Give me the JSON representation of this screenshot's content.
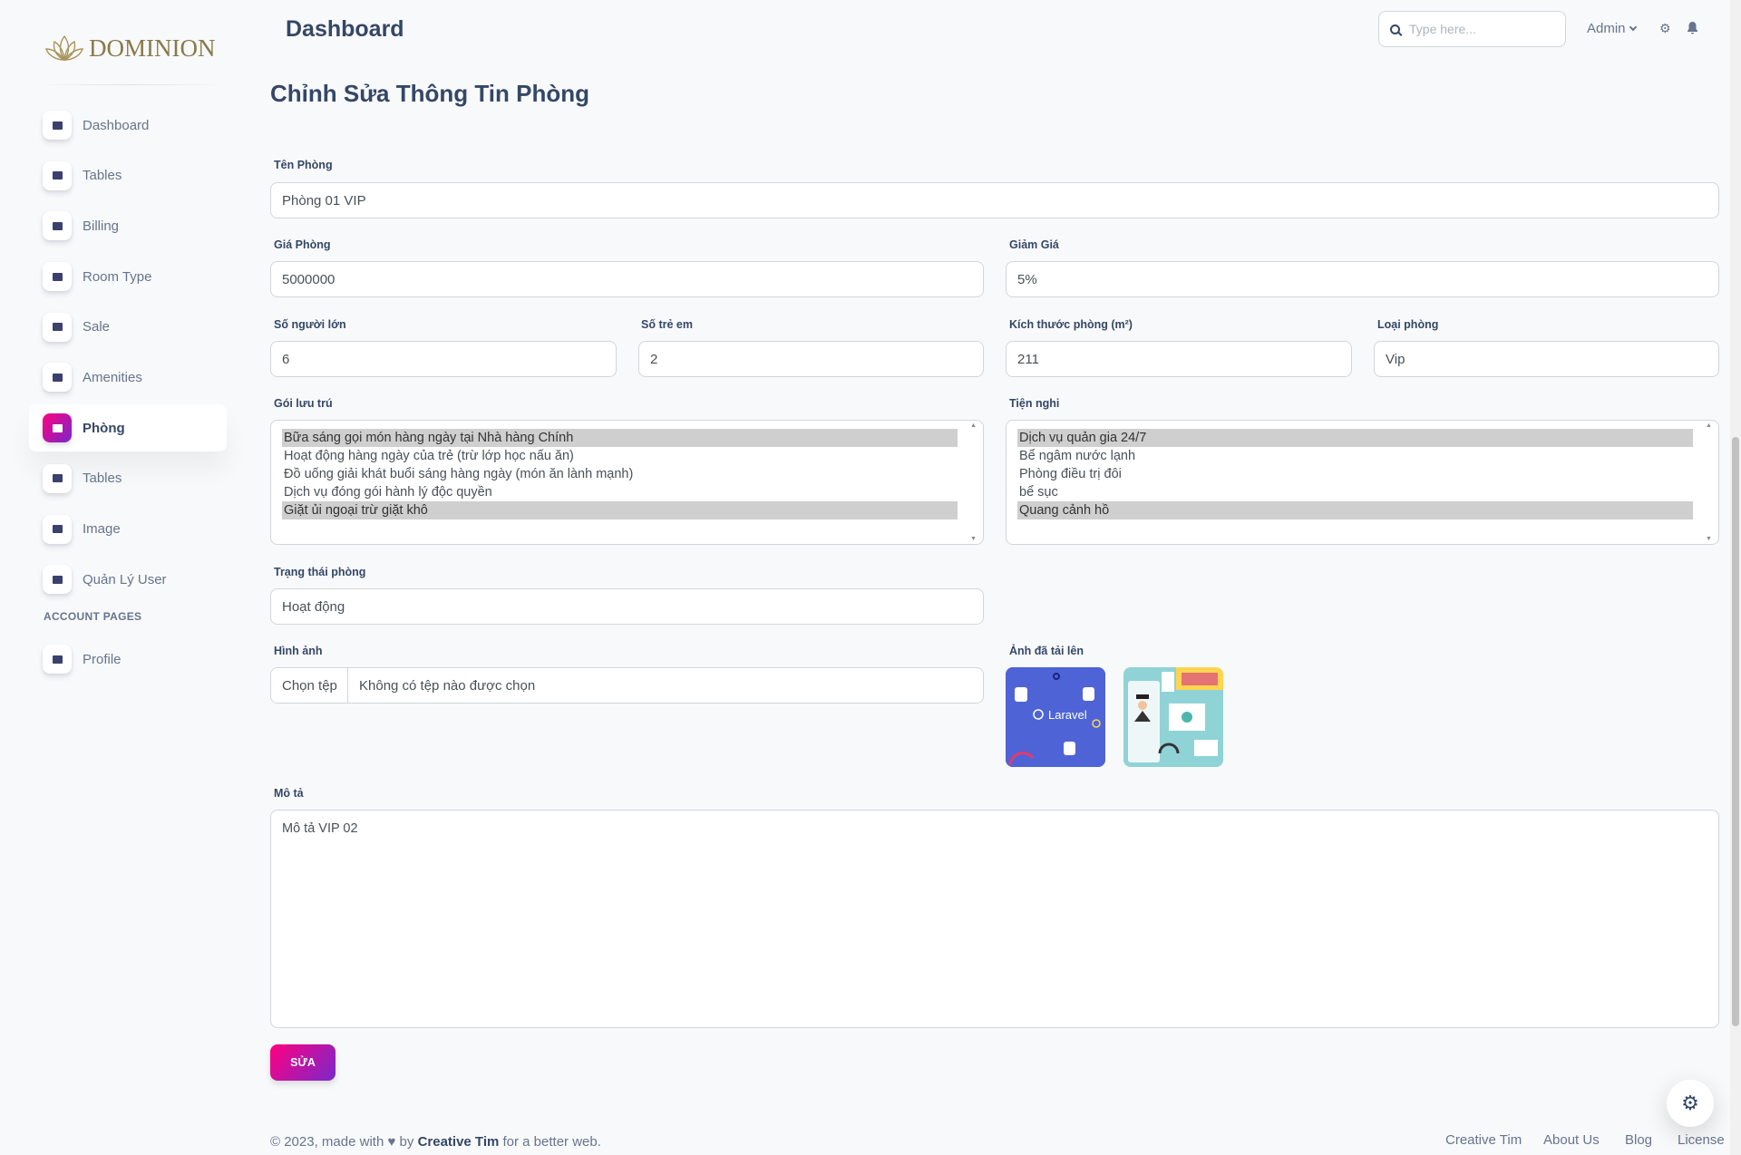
{
  "brand": {
    "name": "DOMINION"
  },
  "sidebar": {
    "items": [
      {
        "label": "Dashboard",
        "icon": "shop-icon"
      },
      {
        "label": "Tables",
        "icon": "office-icon"
      },
      {
        "label": "Billing",
        "icon": "credit-card-icon"
      },
      {
        "label": "Room Type",
        "icon": "app-icon"
      },
      {
        "label": "Sale",
        "icon": "app-icon"
      },
      {
        "label": "Amenities",
        "icon": "app-icon"
      },
      {
        "label": "Phòng",
        "icon": "shop-icon",
        "active": true
      },
      {
        "label": "Tables",
        "icon": "office-icon"
      },
      {
        "label": "Image",
        "icon": "credit-card-icon"
      },
      {
        "label": "Quản Lý User",
        "icon": "credit-card-icon"
      }
    ],
    "section_label": "ACCOUNT PAGES",
    "account_items": [
      {
        "label": "Profile",
        "icon": "user-icon"
      }
    ]
  },
  "header": {
    "title": "Dashboard",
    "search_placeholder": "Type here...",
    "user": "Admin"
  },
  "form": {
    "heading": "Chỉnh Sửa Thông Tin Phòng",
    "room_name": {
      "label": "Tên Phòng",
      "value": "Phòng 01 VIP"
    },
    "price": {
      "label": "Giá Phòng",
      "value": "5000000"
    },
    "discount": {
      "label": "Giảm Giá",
      "value": "5%"
    },
    "adults": {
      "label": "Số người lớn",
      "value": "6"
    },
    "children": {
      "label": "Số trẻ em",
      "value": "2"
    },
    "size": {
      "label": "Kích thước phòng (m²)",
      "value": "211"
    },
    "room_type": {
      "label": "Loại phòng",
      "value": "Vip"
    },
    "packages": {
      "label": "Gói lưu trú",
      "options": [
        {
          "text": "Bữa sáng gọi món hàng ngày tại Nhà hàng Chính",
          "selected": true
        },
        {
          "text": "Hoạt động hàng ngày của trẻ (trừ lớp học nấu ăn)",
          "selected": false
        },
        {
          "text": "Đồ uống giải khát buổi sáng hàng ngày (món ăn lành mạnh)",
          "selected": false
        },
        {
          "text": "Dịch vụ đóng gói hành lý độc quyền",
          "selected": false
        },
        {
          "text": "Giặt ủi ngoại trừ giặt khô",
          "selected": true
        }
      ]
    },
    "amenities": {
      "label": "Tiện nghi",
      "options": [
        {
          "text": "Dịch vụ quản gia 24/7",
          "selected": true
        },
        {
          "text": "Bể ngâm nước lạnh",
          "selected": false
        },
        {
          "text": "Phòng điều trị đôi",
          "selected": false
        },
        {
          "text": "bể sục",
          "selected": false
        },
        {
          "text": "Quang cảnh hồ",
          "selected": true
        }
      ]
    },
    "status": {
      "label": "Trạng thái phòng",
      "value": "Hoạt động"
    },
    "image": {
      "label": "Hình ảnh",
      "button": "Chọn tệp",
      "file_text": "Không có tệp nào được chọn"
    },
    "uploaded": {
      "label": "Ảnh đã tải lên",
      "thumb1_text": "Laravel"
    },
    "description": {
      "label": "Mô tả",
      "value": "Mô tả VIP 02"
    },
    "submit": "SỬA"
  },
  "footer": {
    "copyright": "© 2023, made with",
    "by": "by",
    "author": "Creative Tim",
    "suffix": "for a better web.",
    "links": [
      "Creative Tim",
      "About Us",
      "Blog",
      "License"
    ]
  },
  "colors": {
    "accent_start": "#7928ca",
    "accent_end": "#ff0080",
    "text": "#344767"
  }
}
